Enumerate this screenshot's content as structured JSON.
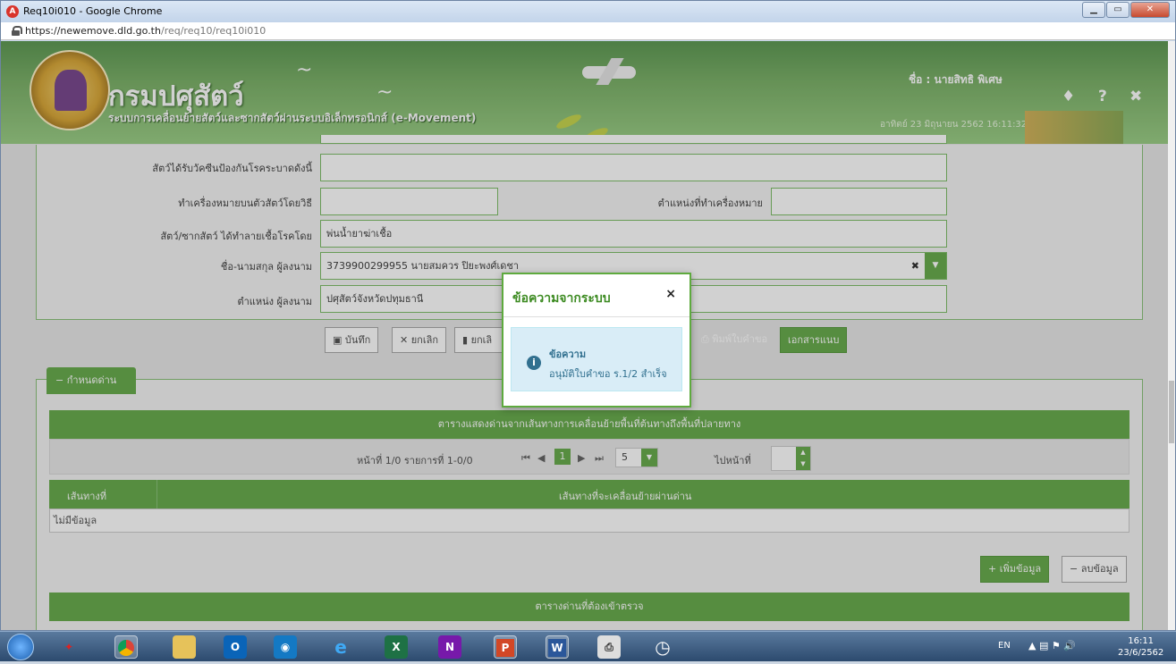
{
  "browser": {
    "tab_title": "Req10i010 - Google Chrome",
    "app_icon": "A",
    "url_host": "https://newemove.dld.go.th",
    "url_path": "/req/req10/req10i010",
    "min_label": "▁",
    "max_label": "▭",
    "close_label": "✕"
  },
  "header": {
    "org_name": "กรมปศุสัตว์",
    "system_name": "ระบบการเคลื่อนย้ายสัตว์และซากสัตว์ผ่านระบบอิเล็กทรอนิกส์ (e-Movement)",
    "user": "ชื่อ : นายสิทธิ พิเศษ",
    "date": "อาทิตย์ 23 มิถุนายน 2562 16:11:32",
    "bell_icon": "bell-icon",
    "help_icon": "help-icon",
    "close_icon": "close-icon"
  },
  "form": {
    "vaccine_label": "สัตว์ได้รับวัคซีนป้องกันโรคระบาดดังนี้",
    "vaccine_value": "",
    "mark_label": "ทำเครื่องหมายบนตัวสัตว์โดยวิธี",
    "mark_value": "",
    "mark_pos_label": "ตำแหน่งที่ทำเครื่องหมาย",
    "mark_pos_value": "",
    "disinfect_label": "สัตว์/ซากสัตว์ ได้ทำลายเชื้อโรคโดย",
    "disinfect_value": "พ่นน้ำยาฆ่าเชื้อ",
    "signer_label": "ชื่อ-นามสกุล ผู้ลงนาม",
    "signer_value": "3739900299955 นายสมควร ปิยะพงศ์เดชา",
    "position_label": "ตำแหน่ง ผู้ลงนาม",
    "position_value": "ปศุสัตว์จังหวัดปทุมธานี"
  },
  "actions": {
    "save": "บันทึก",
    "cancel": "ยกเลิก",
    "delete": "ยกเลิ",
    "print": "พิมพ์ใบคำขอ",
    "attach": "เอกสารแนบ"
  },
  "checkpoint": {
    "tab_label": "กำหนดด่าน",
    "table_title": "ตารางแสดงด่านจากเส้นทางการเคลื่อนย้ายพื้นที่ต้นทางถึงพื้นที่ปลายทาง",
    "page_info": "หน้าที่ 1/0 รายการที่ 1-0/0",
    "current_page": "1",
    "page_size": "5",
    "goto_label": "ไปหน้าที่",
    "col_route": "เส้นทางที่",
    "col_route_pass": "เส้นทางที่จะเคลื่อนย้ายผ่านด่าน",
    "empty_row": "ไม่มีข้อมูล",
    "add_btn": "เพิ่มข้อมูล",
    "remove_btn": "ลบข้อมูล",
    "table2_title": "ตารางด่านที่ต้องเข้าตรวจ"
  },
  "modal": {
    "title": "ข้อความจากระบบ",
    "close": "×",
    "heading": "ข้อความ",
    "message": "อนุมัติใบคำขอ ร.1/2 สำเร็จ"
  },
  "taskbar": {
    "lang": "EN",
    "time": "16:11",
    "date": "23/6/2562"
  },
  "colors": {
    "accent": "#6aad4f",
    "modal_title": "#3d8b22",
    "info": "#31708f"
  }
}
